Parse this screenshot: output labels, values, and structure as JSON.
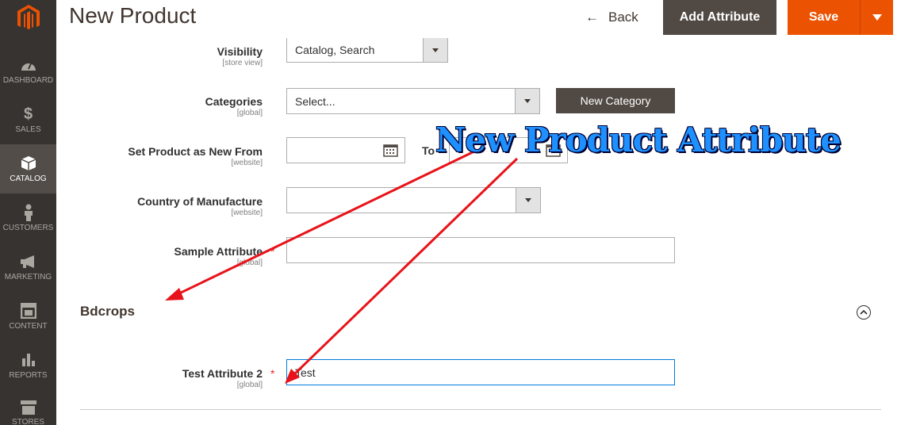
{
  "header": {
    "title": "New Product",
    "back_label": "Back",
    "add_attribute_label": "Add Attribute",
    "save_label": "Save"
  },
  "sidebar": {
    "items": [
      {
        "label": "DASHBOARD",
        "icon": "speedometer-icon"
      },
      {
        "label": "SALES",
        "icon": "dollar-icon"
      },
      {
        "label": "CATALOG",
        "icon": "box-icon",
        "active": true
      },
      {
        "label": "CUSTOMERS",
        "icon": "person-icon"
      },
      {
        "label": "MARKETING",
        "icon": "megaphone-icon"
      },
      {
        "label": "CONTENT",
        "icon": "layout-icon"
      },
      {
        "label": "REPORTS",
        "icon": "bar-chart-icon"
      },
      {
        "label": "STORES",
        "icon": "storefront-icon"
      }
    ]
  },
  "fields": {
    "visibility": {
      "label": "Visibility",
      "scope": "[store view]",
      "value": "Catalog, Search"
    },
    "categories": {
      "label": "Categories",
      "scope": "[global]",
      "value": "Select...",
      "new_button": "New Category"
    },
    "new_from": {
      "label": "Set Product as New From",
      "scope": "[website]",
      "to_label": "To"
    },
    "country": {
      "label": "Country of Manufacture",
      "scope": "[website]",
      "value": ""
    },
    "sample": {
      "label": "Sample Attribute",
      "scope": "[global]",
      "value": ""
    }
  },
  "section": {
    "title": "Bdcrops",
    "test_attribute": {
      "label": "Test Attribute 2",
      "scope": "[global]",
      "value": "Test"
    }
  },
  "annotation": {
    "text": "New Product Attribute"
  },
  "colors": {
    "accent": "#eb5202",
    "sidebar": "#373330",
    "dark_button": "#514943",
    "annotation": "#1e90ff",
    "arrow": "#e8131a"
  }
}
